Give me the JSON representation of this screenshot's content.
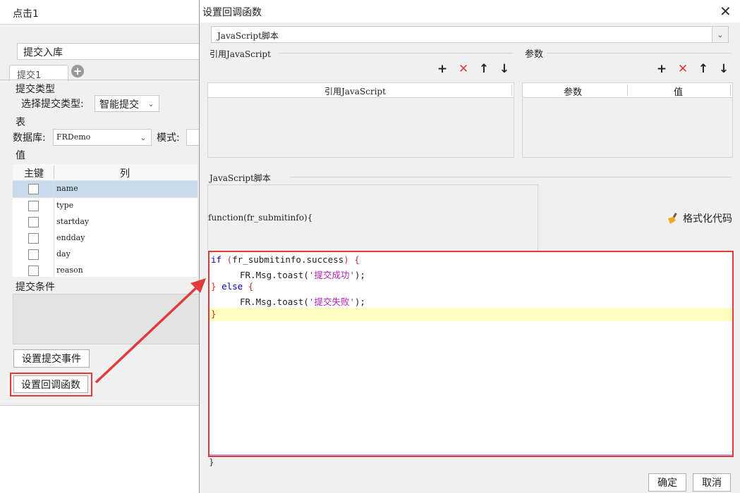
{
  "background_dialog": {
    "title": "点击1",
    "event_name": "提交入库",
    "tab_label": "提交1",
    "submit_type_section": "提交类型",
    "select_type_label": "选择提交类型:",
    "select_type_value": "智能提交",
    "table_section": "表",
    "database_label": "数据库:",
    "database_value": "FRDemo",
    "mode_label": "模式:",
    "value_section": "值",
    "grid_headers": [
      "主键",
      "列"
    ],
    "grid_rows": [
      "name",
      "type",
      "startday",
      "endday",
      "day",
      "reason"
    ],
    "condition_section": "提交条件",
    "set_submit_event_button": "设置提交事件",
    "set_callback_button": "设置回调函数"
  },
  "dialog": {
    "title": "设置回调函数",
    "script_type_value": "JavaScript脚本",
    "ref_section": "引用JavaScript",
    "ref_column": "引用JavaScript",
    "param_section": "参数",
    "param_columns": [
      "参数",
      "值"
    ],
    "script_section": "JavaScript脚本",
    "function_header": "function(fr_submitinfo){",
    "format_button": "格式化代码",
    "code": {
      "l1_if": "if",
      "l1_open": " (",
      "l1_cond": "fr_submitinfo.success",
      "l1_close": ") {",
      "l2_call": "FR.Msg.toast(",
      "l2_str": "'提交成功'",
      "l2_end": ");",
      "l3_close": "} ",
      "l3_else": "else",
      "l3_open": " {",
      "l4_call": "FR.Msg.toast(",
      "l4_str": "'提交失败'",
      "l4_end": ");",
      "l5_close": "}"
    },
    "closing_brace": "}",
    "ok_button": "确定",
    "cancel_button": "取消"
  },
  "colors": {
    "highlight_red": "#e03a3a",
    "keyword_blue": "#0000cc",
    "string_magenta": "#b81fb8",
    "current_line": "#ffffc0",
    "selected_row": "#c7dbec"
  }
}
